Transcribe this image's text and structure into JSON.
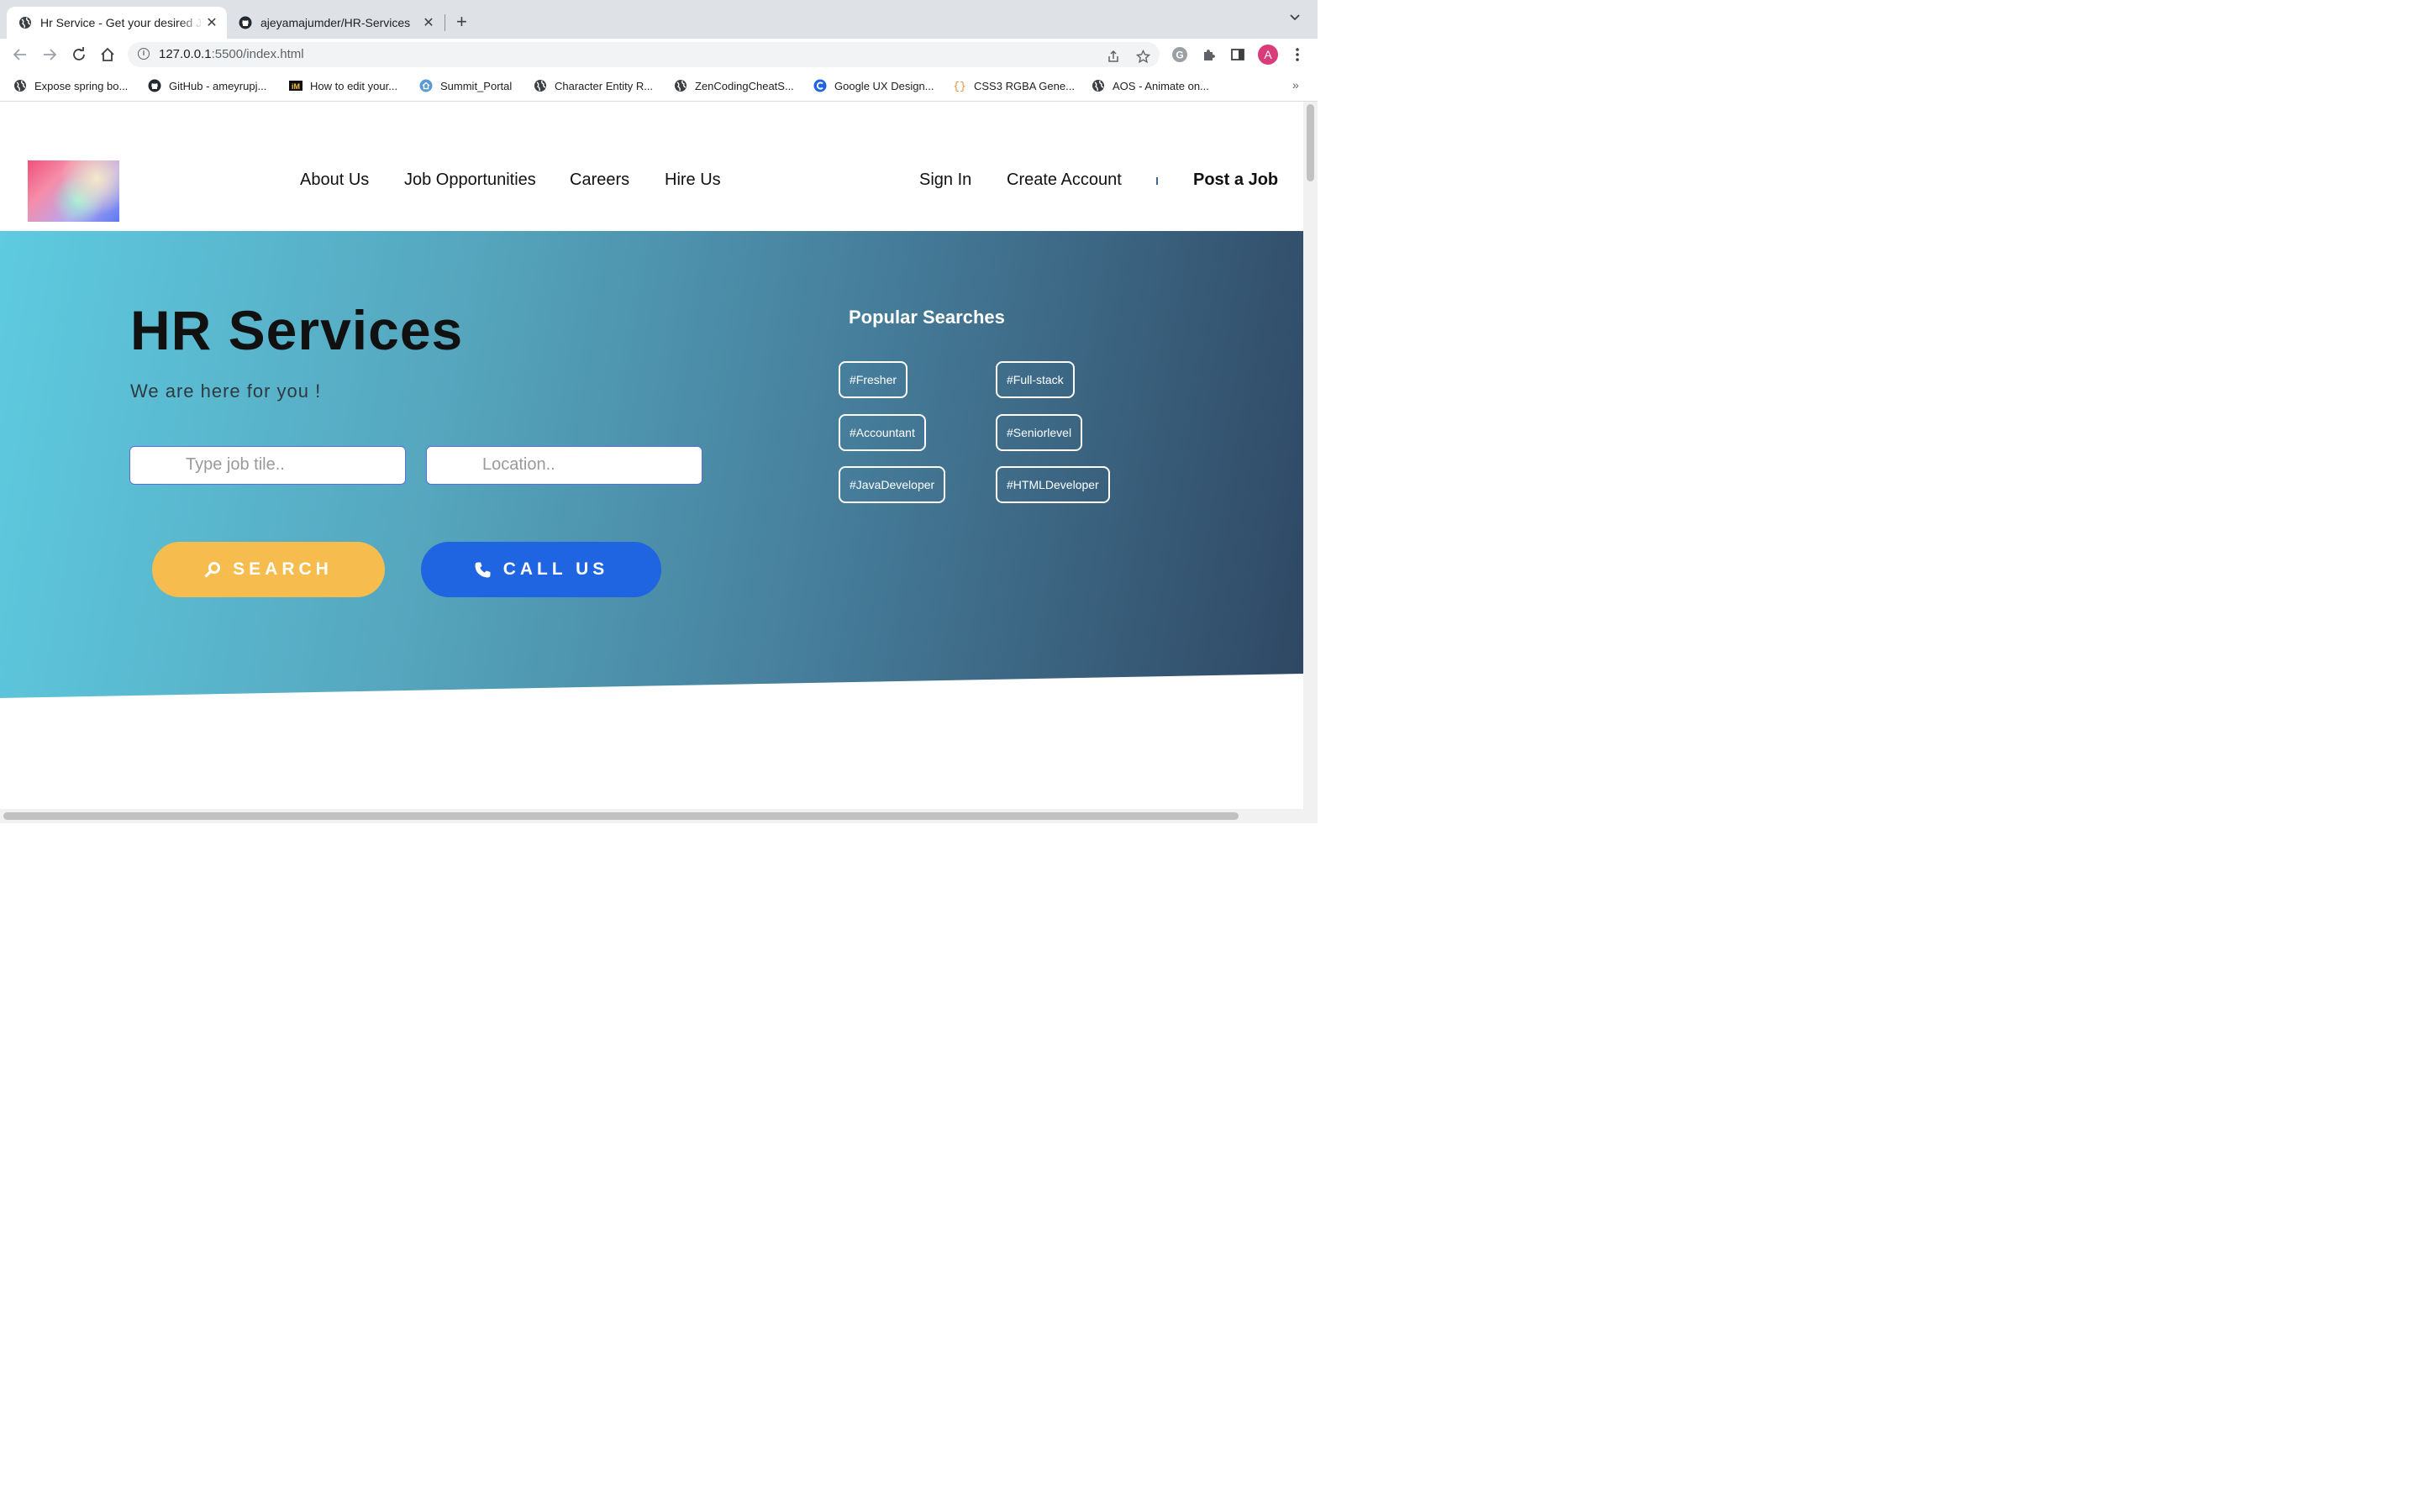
{
  "browser": {
    "tabs": [
      {
        "title": "Hr Service - Get your desired Job",
        "icon": "globe-icon",
        "active": true
      },
      {
        "title": "ajeyamajumder/HR-Services",
        "icon": "github-icon",
        "active": false
      }
    ],
    "tab_close_glyph": "✕",
    "new_tab_glyph": "+",
    "address": {
      "host": "127.0.0.1",
      "rest": ":5500/index.html"
    },
    "profile_initial": "A",
    "bookmarks": [
      {
        "label": "Expose spring bo...",
        "icon": "globe-icon"
      },
      {
        "label": "GitHub - ameyrupj...",
        "icon": "github-icon"
      },
      {
        "label": "How to edit your...",
        "icon": "im-icon"
      },
      {
        "label": "Summit_Portal",
        "icon": "home-badge-icon"
      },
      {
        "label": "Character Entity R...",
        "icon": "globe-icon"
      },
      {
        "label": "ZenCodingCheatS...",
        "icon": "globe-icon"
      },
      {
        "label": "Google UX Design...",
        "icon": "coursera-icon"
      },
      {
        "label": "CSS3 RGBA Gene...",
        "icon": "braces-icon"
      },
      {
        "label": "AOS - Animate on...",
        "icon": "globe-icon"
      }
    ],
    "bookmarks_more": "»"
  },
  "site": {
    "nav": {
      "links": [
        "About Us",
        "Job Opportunities",
        "Careers",
        "Hire Us"
      ],
      "sign_in": "Sign In",
      "create_account": "Create Account",
      "post_job": "Post a Job"
    },
    "hero": {
      "title": "HR Services",
      "subtitle": "We are here for you !",
      "job_placeholder": "Type job tile..",
      "location_placeholder": "Location..",
      "search_label": "SEARCH",
      "call_label": "CALL US"
    },
    "popular": {
      "title": "Popular Searches",
      "tags": [
        "#Fresher",
        "#Full-stack",
        "#Accountant",
        "#Seniorlevel",
        "#JavaDeveloper",
        "#HTMLDeveloper"
      ]
    }
  }
}
